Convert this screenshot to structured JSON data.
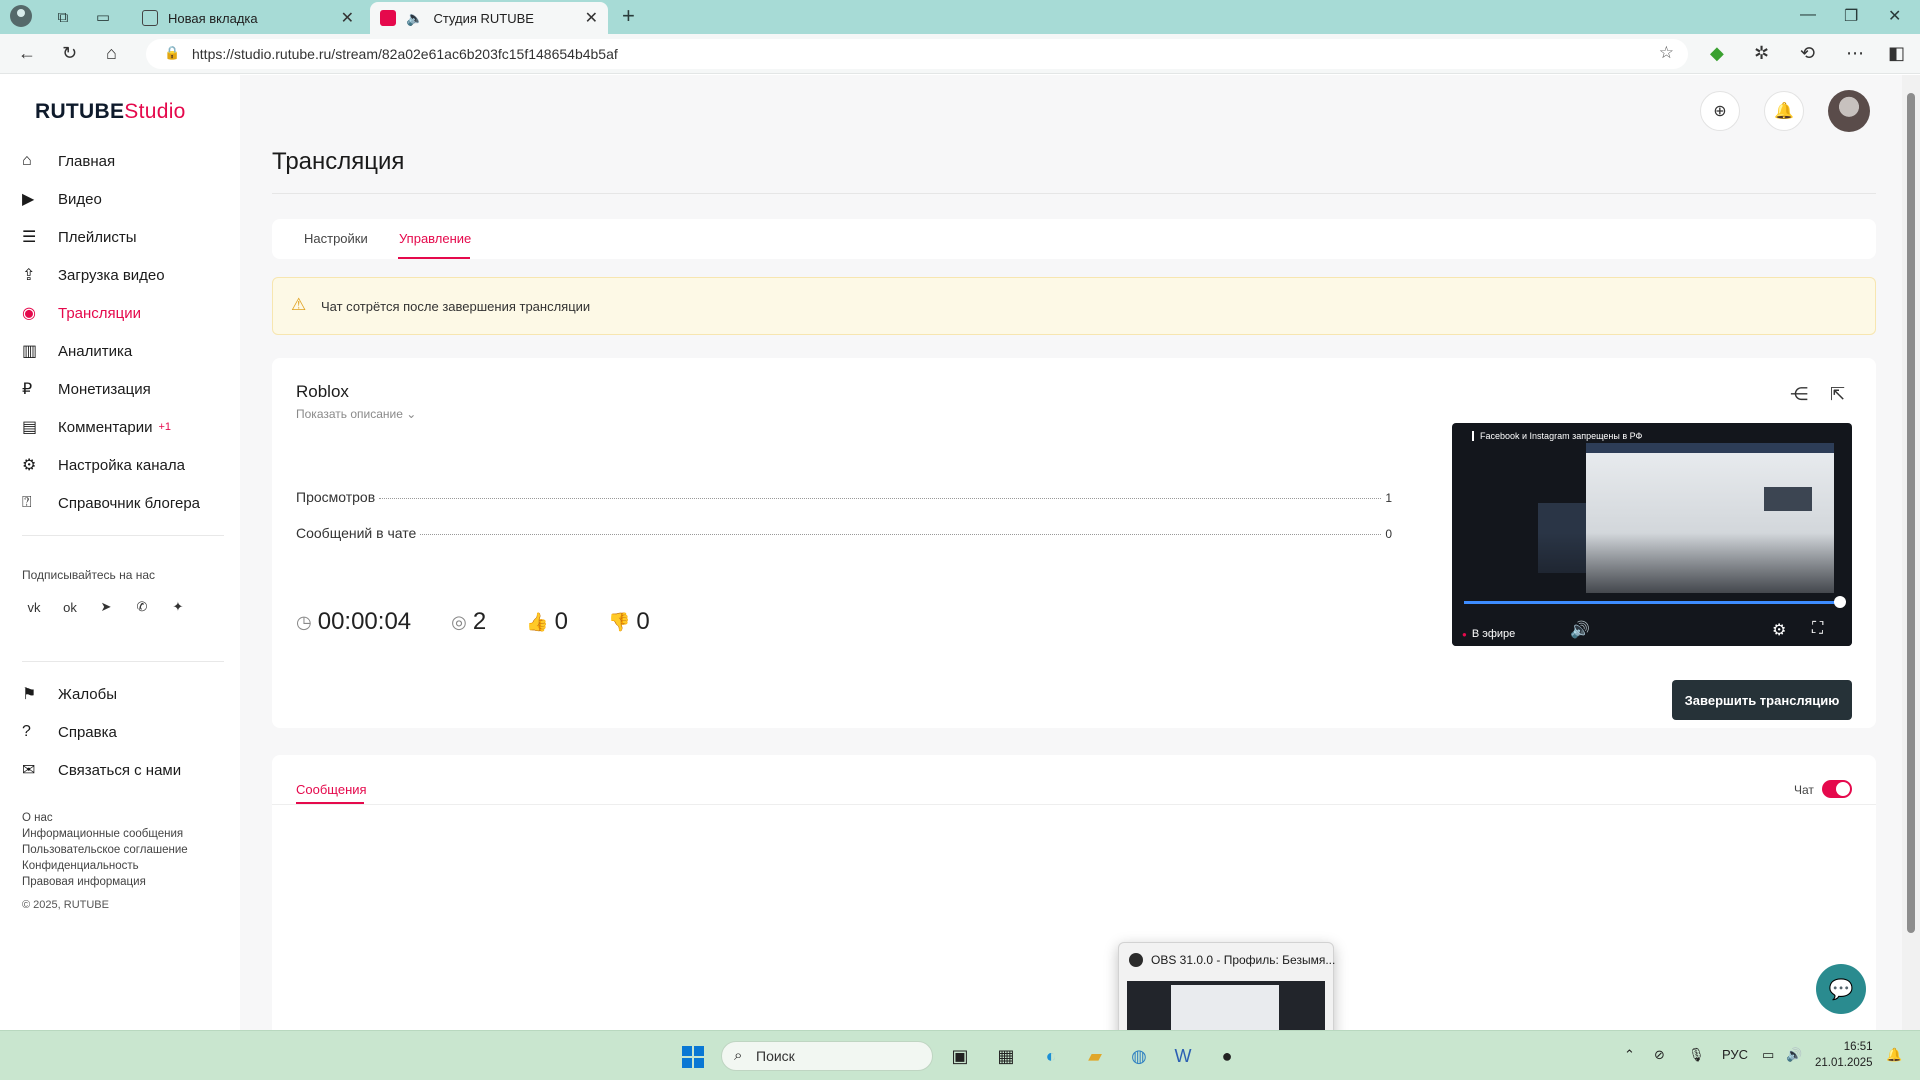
{
  "browser": {
    "tabs": [
      {
        "label": "Новая вкладка"
      },
      {
        "label": "Студия RUTUBE"
      }
    ],
    "url": "https://studio.rutube.ru/stream/82a02e61ac6b203fc15f148654b4b5af"
  },
  "logo": {
    "part1": "RUTUBE",
    "part2": "Studio"
  },
  "sidebar": {
    "items": [
      {
        "label": "Главная",
        "icon": "home-icon"
      },
      {
        "label": "Видео",
        "icon": "video-icon"
      },
      {
        "label": "Плейлисты",
        "icon": "playlist-icon"
      },
      {
        "label": "Загрузка видео",
        "icon": "upload-icon"
      },
      {
        "label": "Трансляции",
        "icon": "broadcast-icon"
      },
      {
        "label": "Аналитика",
        "icon": "analytics-icon"
      },
      {
        "label": "Монетизация",
        "icon": "monetization-icon"
      },
      {
        "label": "Комментарии",
        "icon": "comments-icon",
        "badge": "+1"
      },
      {
        "label": "Настройка канала",
        "icon": "gear-icon"
      },
      {
        "label": "Справочник блогера",
        "icon": "guide-icon"
      }
    ],
    "subscribe_label": "Подписывайтесь на нас",
    "bottom_items": [
      {
        "label": "Жалобы",
        "icon": "flag-icon"
      },
      {
        "label": "Справка",
        "icon": "help-icon"
      },
      {
        "label": "Связаться с нами",
        "icon": "mail-icon"
      }
    ],
    "footer_links": [
      "О нас",
      "Информационные сообщения",
      "Пользовательское соглашение",
      "Конфиденциальность",
      "Правовая информация"
    ],
    "copyright": "© 2025, RUTUBE"
  },
  "page": {
    "title": "Трансляция",
    "tabs": [
      "Настройки",
      "Управление"
    ],
    "warning": "Чат сотрётся после завершения трансляции"
  },
  "stream": {
    "name": "Roblox",
    "show_description": "Показать описание",
    "stats": [
      {
        "label": "Просмотров",
        "value": "1"
      },
      {
        "label": "Сообщений в чате",
        "value": "0"
      }
    ],
    "duration": "00:00:04",
    "viewers": "2",
    "likes": "0",
    "dislikes": "0",
    "player": {
      "video_title": "Facebook и Instagram запрещены в РФ",
      "live_label": "В эфире",
      "progress": 1.0
    },
    "end_button": "Завершить трансляцию"
  },
  "messages": {
    "tab": "Сообщения",
    "chat_label": "Чат",
    "chat_enabled": true
  },
  "obs_preview": {
    "title": "OBS 31.0.0 - Профиль: Безымя..."
  },
  "taskbar": {
    "search_placeholder": "Поиск",
    "language": "РУС",
    "time": "16:51",
    "date": "21.01.2025"
  },
  "colors": {
    "accent": "#e5094c",
    "dark_button": "#263238",
    "warning_bg": "#fdf9e6"
  }
}
